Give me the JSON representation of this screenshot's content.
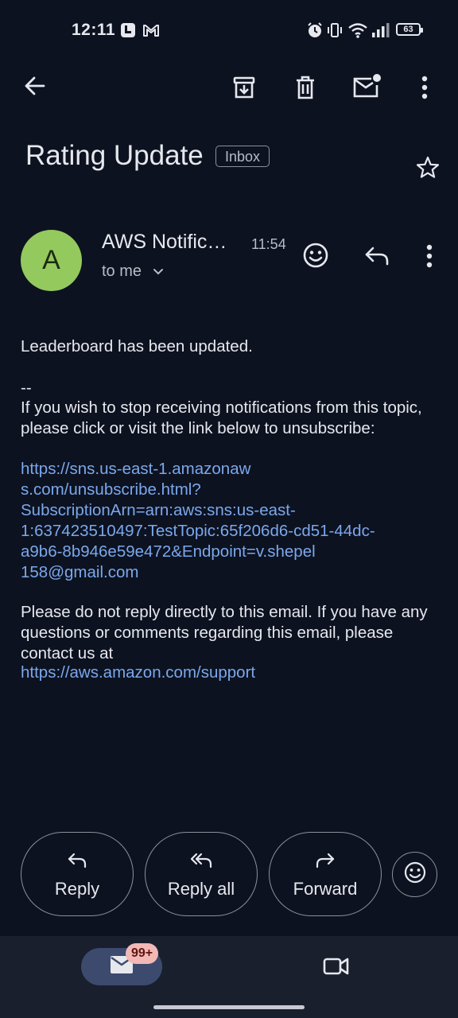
{
  "status_bar": {
    "time": "12:11",
    "battery": "63",
    "icons": [
      "notes-app-icon",
      "gmail-notification-icon",
      "alarm-icon",
      "vibrate-icon",
      "wifi-icon",
      "signal-icon",
      "battery-icon"
    ]
  },
  "app_bar": {
    "icons": [
      "back-arrow-icon",
      "archive-icon",
      "delete-icon",
      "mark-unread-icon",
      "more-vert-icon"
    ]
  },
  "email": {
    "subject": "Rating Update",
    "label": "Inbox",
    "sender": {
      "avatar_letter": "A",
      "avatar_color": "#94c95e",
      "name": "AWS Notific…",
      "time": "11:54",
      "recipient": "to me"
    },
    "body": {
      "line1": "Leaderboard has been updated.",
      "separator": "--",
      "unsubscribe_text": "If you wish to stop receiving notifications from this topic, please click or visit the link below to unsubscribe:",
      "unsubscribe_link": "https://sns.us-east-1.amazonaws.com/unsubscribe.html?SubscriptionArn=arn:aws:sns:us-east-1:637423510497:TestTopic:65f206d6-cd51-44dc-a9b6-8b946e59e472&Endpoint=v.shepel158@gmail.com",
      "unsubscribe_link_lines": [
        "https://sns.us-east-1.amazonaw",
        "s.com/unsubscribe.html?",
        "SubscriptionArn=arn:aws:sns:us-east-",
        "1:637423510497:TestTopic:65f206d6-cd51-44dc-",
        "a9b6-8b946e59e472&Endpoint=v.shepel",
        "158@gmail.com"
      ],
      "contact_text": "Please do not reply directly to this email. If you have any questions or comments regarding this email, please contact us at",
      "support_link": "https://aws.amazon.com/support"
    }
  },
  "actions": {
    "reply": "Reply",
    "reply_all": "Reply all",
    "forward": "Forward"
  },
  "bottom_nav": {
    "mail_badge": "99+"
  },
  "colors": {
    "background": "#0d1220",
    "link": "#7aa8ec",
    "nav_background": "#1a1f2d",
    "nav_active": "#3c4a6e",
    "badge": "#f2b8b5"
  }
}
